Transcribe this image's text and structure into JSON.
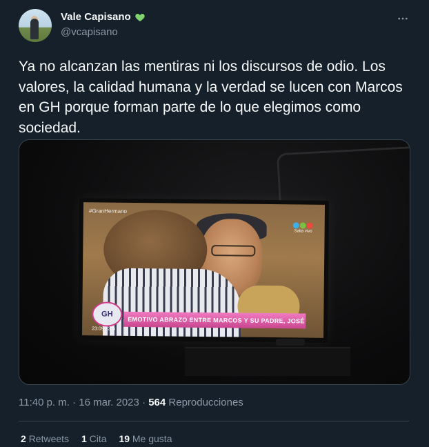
{
  "author": {
    "name": "Vale Capisano",
    "handle": "@vcapisano",
    "badge_icon": "green-heart-icon",
    "badge_color": "#7fd36e"
  },
  "tweet": {
    "text": "Ya no alcanzan las mentiras ni los discursos de odio. Los valores, la calidad humana y la verdad se lucen con Marcos en GH porque forman parte de lo que elegimos como sociedad."
  },
  "media": {
    "hashtag": "#GranHermano",
    "banner": "EMOTIVO ABRAZO ENTRE MARCOS Y SU PADRE, JOSÉ",
    "gh_logo": "GH",
    "clock": "23:09  22°5",
    "channel_label": "Salta\nvivo"
  },
  "meta": {
    "time": "11:40 p. m.",
    "separator1": "·",
    "date": "16 mar. 2023",
    "separator2": "·",
    "views_count": "564",
    "views_label": "Reproducciones"
  },
  "stats": {
    "retweets_count": "2",
    "retweets_label": "Retweets",
    "quotes_count": "1",
    "quotes_label": "Cita",
    "likes_count": "19",
    "likes_label": "Me gusta"
  },
  "colors": {
    "background": "#15202b",
    "text_primary": "#f7f9f9",
    "text_secondary": "#8b98a5",
    "border": "#38444d"
  }
}
